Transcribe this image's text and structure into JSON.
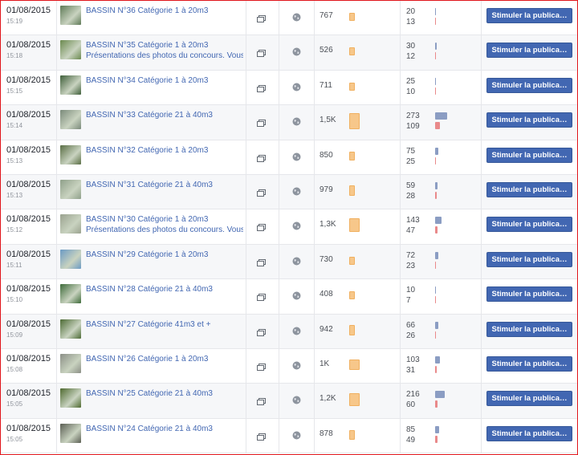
{
  "posts": [
    {
      "date": "01/08/2015",
      "time": "15:19",
      "title": "BASSIN N°36 Catégorie 1 à 20m3",
      "subtitle": "",
      "reach": "767",
      "reach_value": 767,
      "engagement_top": "20",
      "engagement_bottom": "13",
      "boost_label": "Stimuler la publica…",
      "thumb_color": "#5f7a57"
    },
    {
      "date": "01/08/2015",
      "time": "15:18",
      "title": "BASSIN N°35 Catégorie 1 à 20m3",
      "subtitle": "Présentations des photos du concours. Vous",
      "reach": "526",
      "reach_value": 526,
      "engagement_top": "30",
      "engagement_bottom": "12",
      "boost_label": "Stimuler la publica…",
      "thumb_color": "#6b8a4f"
    },
    {
      "date": "01/08/2015",
      "time": "15:15",
      "title": "BASSIN N°34 Catégorie 1 à 20m3",
      "subtitle": "",
      "reach": "711",
      "reach_value": 711,
      "engagement_top": "25",
      "engagement_bottom": "10",
      "boost_label": "Stimuler la publica…",
      "thumb_color": "#3f5f3a"
    },
    {
      "date": "01/08/2015",
      "time": "15:14",
      "title": "BASSIN N°33 Catégorie 21 à 40m3",
      "subtitle": "",
      "reach": "1,5K",
      "reach_value": 1500,
      "engagement_top": "273",
      "engagement_bottom": "109",
      "boost_label": "Stimuler la publica…",
      "thumb_color": "#7a8a7a"
    },
    {
      "date": "01/08/2015",
      "time": "15:13",
      "title": "BASSIN N°32 Catégorie 1 à 20m3",
      "subtitle": "",
      "reach": "850",
      "reach_value": 850,
      "engagement_top": "75",
      "engagement_bottom": "25",
      "boost_label": "Stimuler la publica…",
      "thumb_color": "#5a6e45"
    },
    {
      "date": "01/08/2015",
      "time": "15:13",
      "title": "BASSIN N°31 Catégorie 21 à 40m3",
      "subtitle": "",
      "reach": "979",
      "reach_value": 979,
      "engagement_top": "59",
      "engagement_bottom": "28",
      "boost_label": "Stimuler la publica…",
      "thumb_color": "#8fa08a"
    },
    {
      "date": "01/08/2015",
      "time": "15:12",
      "title": "BASSIN N°30 Catégorie 1 à 20m3",
      "subtitle": "Présentations des photos du concours. Vous",
      "reach": "1,3K",
      "reach_value": 1300,
      "engagement_top": "143",
      "engagement_bottom": "47",
      "boost_label": "Stimuler la publica…",
      "thumb_color": "#9aa28f"
    },
    {
      "date": "01/08/2015",
      "time": "15:11",
      "title": "BASSIN N°29 Catégorie 1 à 20m3",
      "subtitle": "",
      "reach": "730",
      "reach_value": 730,
      "engagement_top": "72",
      "engagement_bottom": "23",
      "boost_label": "Stimuler la publica…",
      "thumb_color": "#6b9ac4"
    },
    {
      "date": "01/08/2015",
      "time": "15:10",
      "title": "BASSIN N°28 Catégorie 21 à 40m3",
      "subtitle": "",
      "reach": "408",
      "reach_value": 408,
      "engagement_top": "10",
      "engagement_bottom": "7",
      "boost_label": "Stimuler la publica…",
      "thumb_color": "#3e6b3a"
    },
    {
      "date": "01/08/2015",
      "time": "15:09",
      "title": "BASSIN N°27 Catégorie 41m3 et +",
      "subtitle": "",
      "reach": "942",
      "reach_value": 942,
      "engagement_top": "66",
      "engagement_bottom": "26",
      "boost_label": "Stimuler la publica…",
      "thumb_color": "#4d6b35"
    },
    {
      "date": "01/08/2015",
      "time": "15:08",
      "title": "BASSIN N°26 Catégorie 1 à 20m3",
      "subtitle": "",
      "reach": "1K",
      "reach_value": 1000,
      "engagement_top": "103",
      "engagement_bottom": "31",
      "boost_label": "Stimuler la publica…",
      "thumb_color": "#8b8f86"
    },
    {
      "date": "01/08/2015",
      "time": "15:05",
      "title": "BASSIN N°25 Catégorie 21 à 40m3",
      "subtitle": "",
      "reach": "1,2K",
      "reach_value": 1200,
      "engagement_top": "216",
      "engagement_bottom": "60",
      "boost_label": "Stimuler la publica…",
      "thumb_color": "#4f6a30"
    },
    {
      "date": "01/08/2015",
      "time": "15:05",
      "title": "BASSIN N°24 Catégorie 21 à 40m3",
      "subtitle": "",
      "reach": "878",
      "reach_value": 878,
      "engagement_top": "85",
      "engagement_bottom": "49",
      "boost_label": "Stimuler la publica…",
      "thumb_color": "#5b5f54"
    }
  ],
  "colors": {
    "link": "#4267b2",
    "reach_bar": "#f7c78a",
    "engagement_bar_top": "#8b9dc3",
    "engagement_bar_bottom": "#e9898a",
    "button": "#4267b2",
    "frame_border": "#e0151b"
  },
  "icons": {
    "type": "share-box-icon",
    "privacy": "globe-icon"
  }
}
